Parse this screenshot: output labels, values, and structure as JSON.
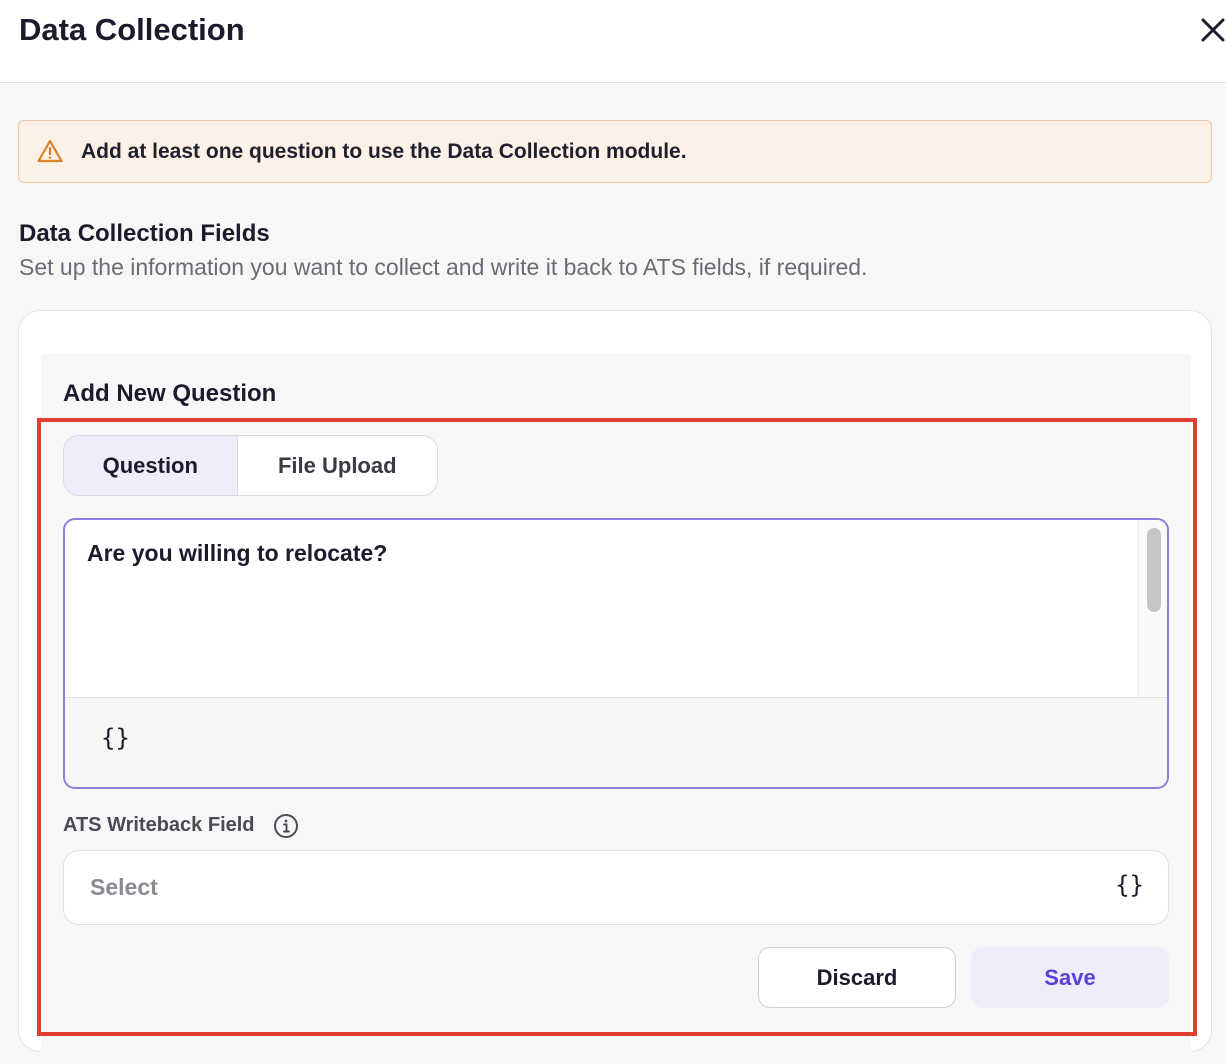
{
  "header": {
    "title": "Data Collection",
    "close_icon": "close-icon"
  },
  "alert": {
    "icon": "warning-icon",
    "text": "Add at least one question to use the Data Collection module.",
    "color": "#d9822b"
  },
  "section": {
    "title": "Data Collection Fields",
    "subtitle": "Set up the information you want to collect and write it back to ATS fields, if required."
  },
  "add_question": {
    "title": "Add New Question",
    "tabs": [
      {
        "label": "Question",
        "selected": true
      },
      {
        "label": "File Upload",
        "selected": false
      }
    ],
    "editor": {
      "value": "Are you willing to relocate?",
      "variable_button": "{}"
    },
    "ats_field": {
      "label": "ATS Writeback Field",
      "placeholder": "Select",
      "variable_button": "{}"
    },
    "buttons": {
      "discard": "Discard",
      "save": "Save"
    }
  },
  "colors": {
    "accent": "#5b3fd6",
    "highlight": "#e03e2f",
    "selected_tab": "#efecfb"
  }
}
